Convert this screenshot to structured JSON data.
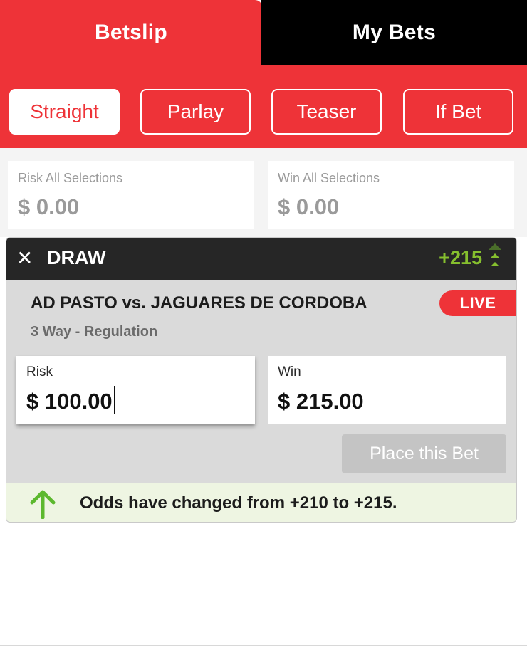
{
  "tabs": {
    "betslip": "Betslip",
    "my_bets": "My Bets"
  },
  "bet_types": {
    "straight": "Straight",
    "parlay": "Parlay",
    "teaser": "Teaser",
    "if_bet": "If Bet",
    "active": "Straight"
  },
  "all_selections": {
    "risk_label": "Risk All Selections",
    "risk_value": "$ 0.00",
    "win_label": "Win All Selections",
    "win_value": "$ 0.00"
  },
  "bet": {
    "selection": "DRAW",
    "odds": "+215",
    "match": "AD PASTO vs. JAGUARES DE CORDOBA",
    "market": "3 Way - Regulation",
    "live_badge": "LIVE",
    "risk_label": "Risk",
    "risk_value": "$ 100.00",
    "win_label": "Win",
    "win_value": "$ 215.00",
    "place_button": "Place this Bet",
    "odds_change_message": "Odds have changed from +210 to +215."
  },
  "colors": {
    "brand_red": "#ee3338",
    "dark": "#262626",
    "odds_green": "#86bf2e",
    "arrow_green": "#5cb82e"
  },
  "icons": {
    "close": "close-icon",
    "odds_direction": "odds-up-arrows-icon",
    "odds_changed": "arrow-up-icon"
  }
}
